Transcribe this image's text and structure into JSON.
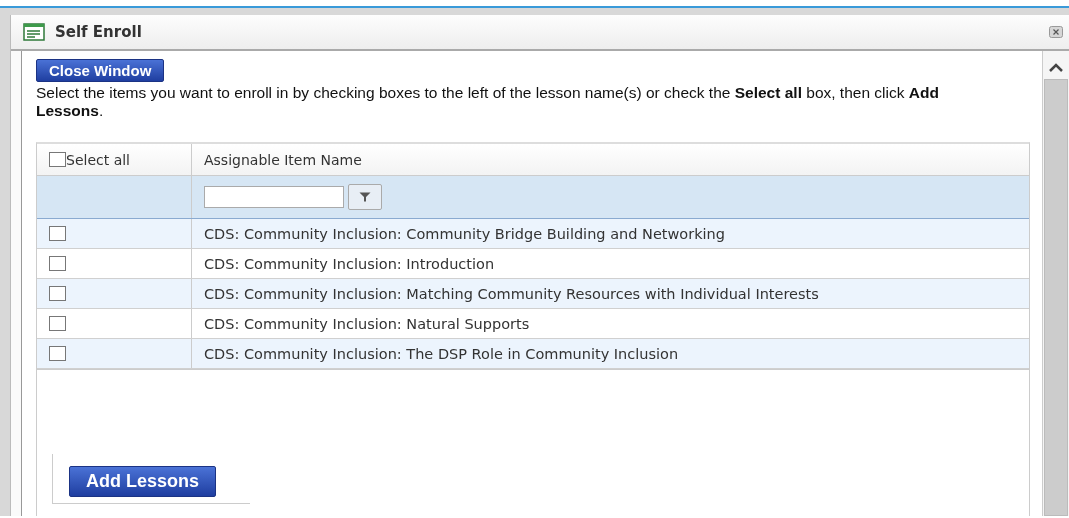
{
  "window": {
    "title": "Self Enroll"
  },
  "close_window_button": "Close Window",
  "instructions": "Select the items you want to enroll in by checking boxes to the left of the lesson name(s) or check the **Select all** box, then click **Add Lessons**.",
  "table": {
    "select_all": {
      "label": "Select all",
      "checked": false
    },
    "columns": [
      "Assignable Item Name"
    ],
    "rows": [
      {
        "name": "CDS: Community Inclusion: Community Bridge Building and Networking",
        "checked": false
      },
      {
        "name": "CDS: Community Inclusion: Introduction",
        "checked": false
      },
      {
        "name": "CDS: Community Inclusion: Matching Community Resources with Individual Interests",
        "checked": false
      },
      {
        "name": "CDS: Community Inclusion: Natural Supports",
        "checked": false
      },
      {
        "name": "CDS: Community Inclusion: The DSP Role in Community Inclusion",
        "checked": false
      }
    ]
  },
  "add_lessons_button": "Add Lessons"
}
